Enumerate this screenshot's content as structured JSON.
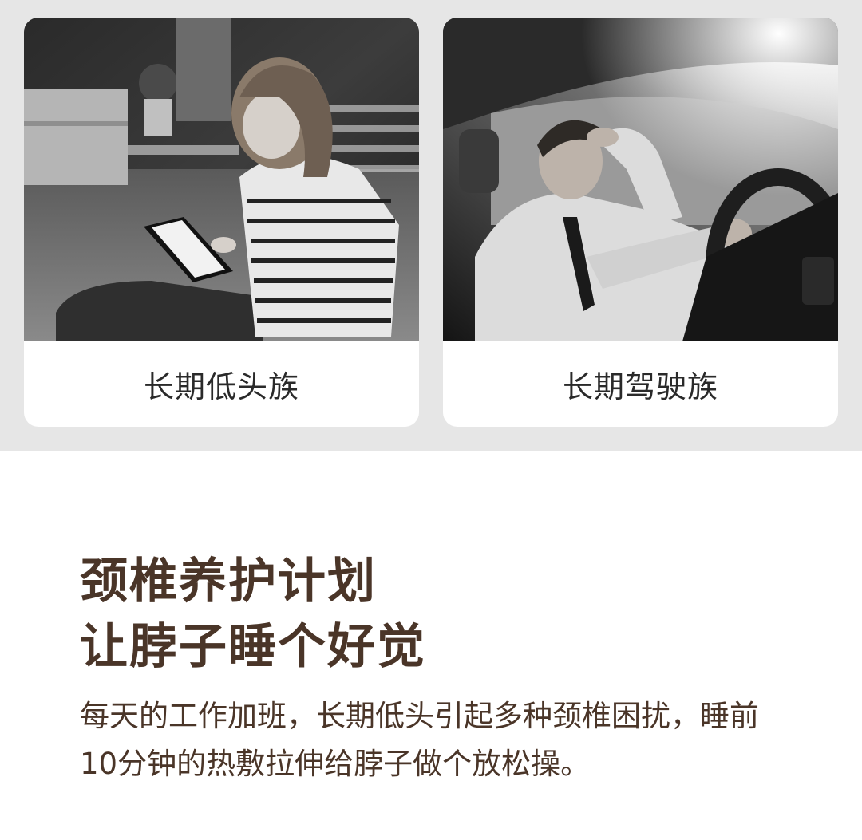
{
  "cards": [
    {
      "caption": "长期低头族",
      "image": "woman-sitting-on-floor-using-tablet-photo"
    },
    {
      "caption": "长期驾驶族",
      "image": "tired-man-driving-car-photo"
    }
  ],
  "headline": {
    "line1": "颈椎养护计划",
    "line2": "让脖子睡个好觉"
  },
  "body": "每天的工作加班，长期低头引起多种颈椎困扰，睡前10分钟的热敷拉伸给脖子做个放松操。",
  "colors": {
    "band_background": "#e6e6e6",
    "card_background": "#ffffff",
    "caption_text": "#2a2a2a",
    "headline_text": "#4a3528",
    "body_text": "#4a3528"
  }
}
